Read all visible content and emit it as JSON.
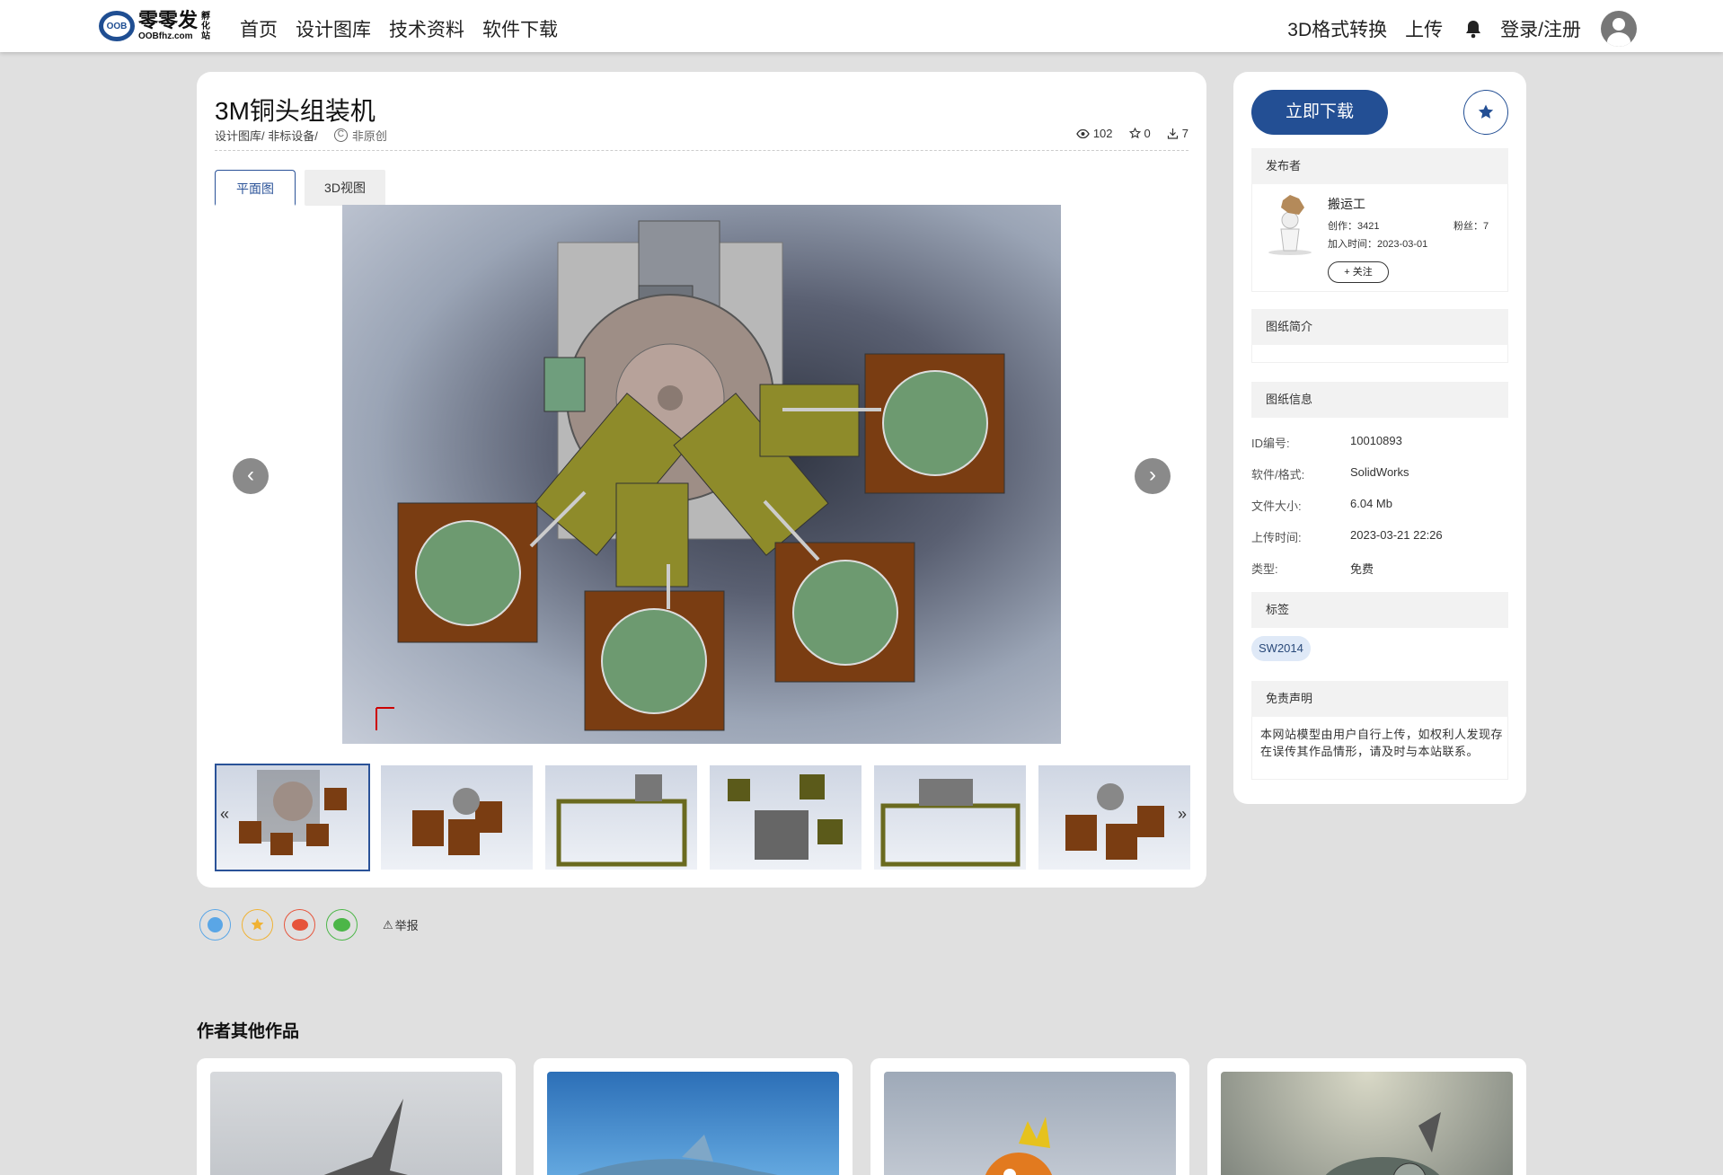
{
  "header": {
    "logo_text": "零零发",
    "logo_sub": "孵化站",
    "logo_domain": "OOBfhz.com",
    "logo_mark": "OOB",
    "nav": [
      "首页",
      "设计图库",
      "技术资料",
      "软件下载"
    ],
    "right_nav": {
      "convert": "3D格式转换",
      "upload": "上传",
      "login": "登录/注册"
    }
  },
  "model": {
    "title": "3M铜头组装机",
    "breadcrumb": "设计图库/ 非标设备/",
    "originality": "非原创",
    "views": "102",
    "favorites": "0",
    "downloads": "7"
  },
  "tabs": [
    "平面图",
    "3D视图"
  ],
  "viewer": {
    "prev": "‹",
    "next": "›"
  },
  "thumbs": {
    "prev": "«",
    "next": "»",
    "count": 6
  },
  "share": {
    "report": "举报"
  },
  "sidebar": {
    "download": "立即下载",
    "publisher_section": "发布者",
    "publisher": {
      "name": "搬运工",
      "works": "创作：3421",
      "fans": "粉丝：7",
      "joined": "加入时间：2023-03-01",
      "follow": "+ 关注"
    },
    "intro_section": "图纸简介",
    "info_section": "图纸信息",
    "info": [
      {
        "k": "ID编号:",
        "v": "10010893"
      },
      {
        "k": "软件/格式:",
        "v": "SolidWorks"
      },
      {
        "k": "文件大小:",
        "v": "6.04 Mb"
      },
      {
        "k": "上传时间:",
        "v": "2023-03-21 22:26"
      },
      {
        "k": "类型:",
        "v": "免费"
      }
    ],
    "tags_section": "标签",
    "tag": "SW2014",
    "disclaimer_section": "免责声明",
    "disclaimer": "本网站模型由用户自行上传，如权利人发现存在误传其作品情形，请及时与本站联系。"
  },
  "other_works": {
    "title": "作者其他作品"
  },
  "colors": {
    "brand": "#234f94",
    "accent_tab": "#2a5298",
    "bg": "#e0e0e0"
  }
}
